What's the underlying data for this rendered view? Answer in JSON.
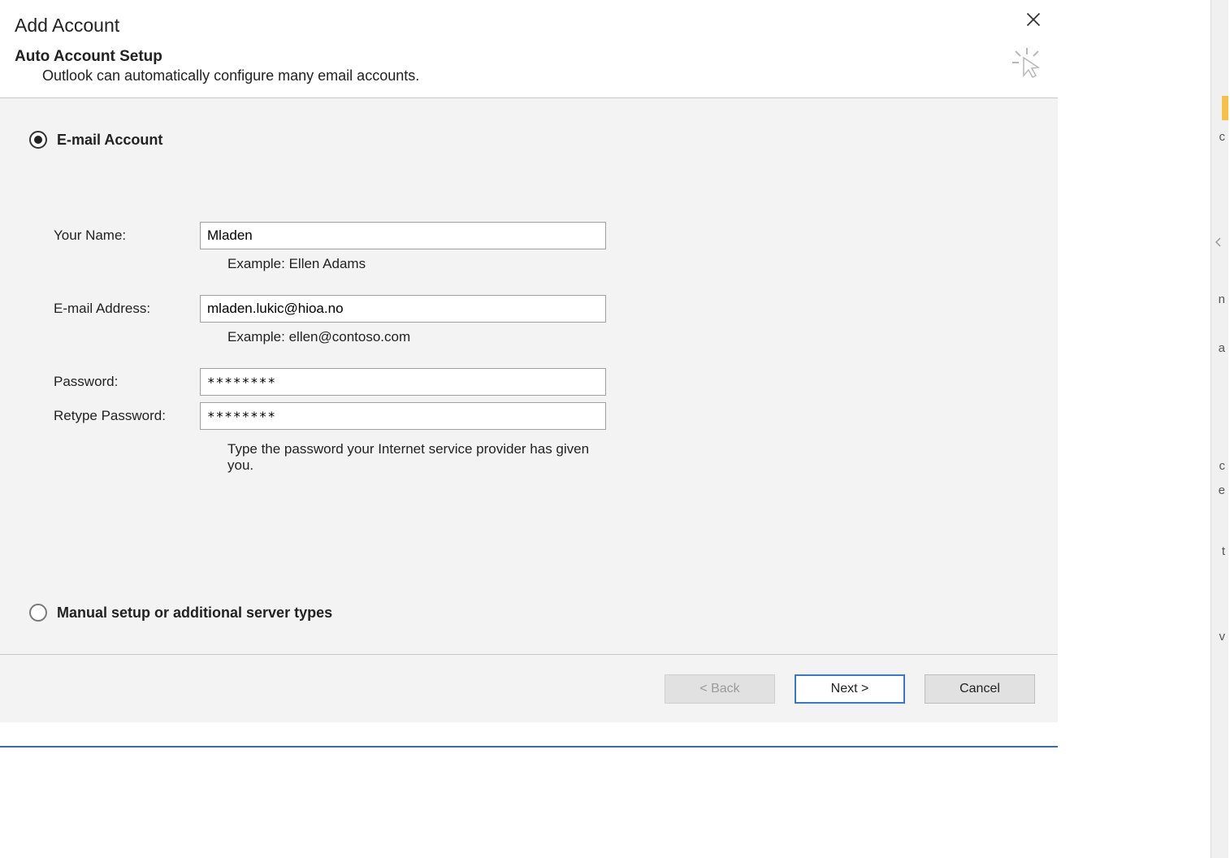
{
  "dialog": {
    "title": "Add Account",
    "subtitle": "Auto Account Setup",
    "subdesc": "Outlook can automatically configure many email accounts."
  },
  "options": {
    "email_account_label": "E-mail Account",
    "manual_setup_label": "Manual setup or additional server types",
    "selected": "email_account"
  },
  "form": {
    "name_label": "Your Name:",
    "name_value": "Mladen",
    "name_example": "Example: Ellen Adams",
    "email_label": "E-mail Address:",
    "email_value": "mladen.lukic@hioa.no",
    "email_example": "Example: ellen@contoso.com",
    "password_label": "Password:",
    "password_value": "********",
    "retype_label": "Retype Password:",
    "retype_value": "********",
    "password_hint": "Type the password your Internet service provider has given you."
  },
  "buttons": {
    "back": "< Back",
    "next": "Next >",
    "cancel": "Cancel"
  }
}
